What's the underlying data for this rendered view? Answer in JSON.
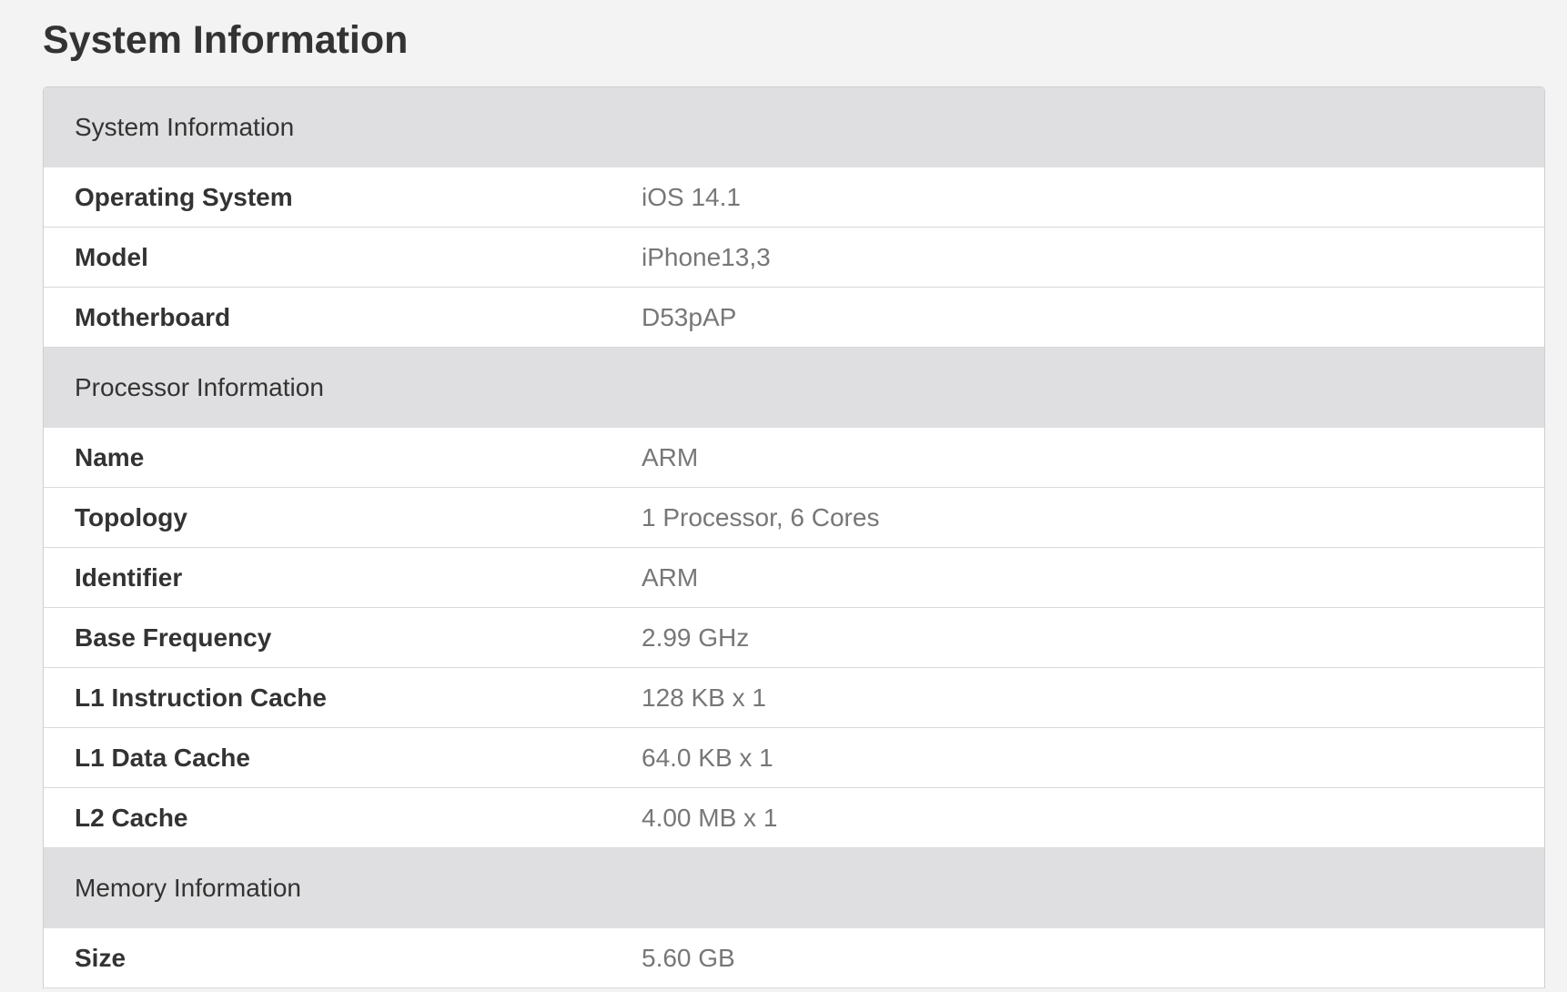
{
  "page": {
    "title": "System Information"
  },
  "sections": [
    {
      "title": "System Information",
      "rows": [
        {
          "label": "Operating System",
          "value": "iOS 14.1"
        },
        {
          "label": "Model",
          "value": "iPhone13,3"
        },
        {
          "label": "Motherboard",
          "value": "D53pAP"
        }
      ]
    },
    {
      "title": "Processor Information",
      "rows": [
        {
          "label": "Name",
          "value": "ARM"
        },
        {
          "label": "Topology",
          "value": "1 Processor, 6 Cores"
        },
        {
          "label": "Identifier",
          "value": "ARM"
        },
        {
          "label": "Base Frequency",
          "value": "2.99 GHz"
        },
        {
          "label": "L1 Instruction Cache",
          "value": "128 KB x 1"
        },
        {
          "label": "L1 Data Cache",
          "value": "64.0 KB x 1"
        },
        {
          "label": "L2 Cache",
          "value": "4.00 MB x 1"
        }
      ]
    },
    {
      "title": "Memory Information",
      "rows": [
        {
          "label": "Size",
          "value": "5.60 GB"
        }
      ]
    }
  ]
}
